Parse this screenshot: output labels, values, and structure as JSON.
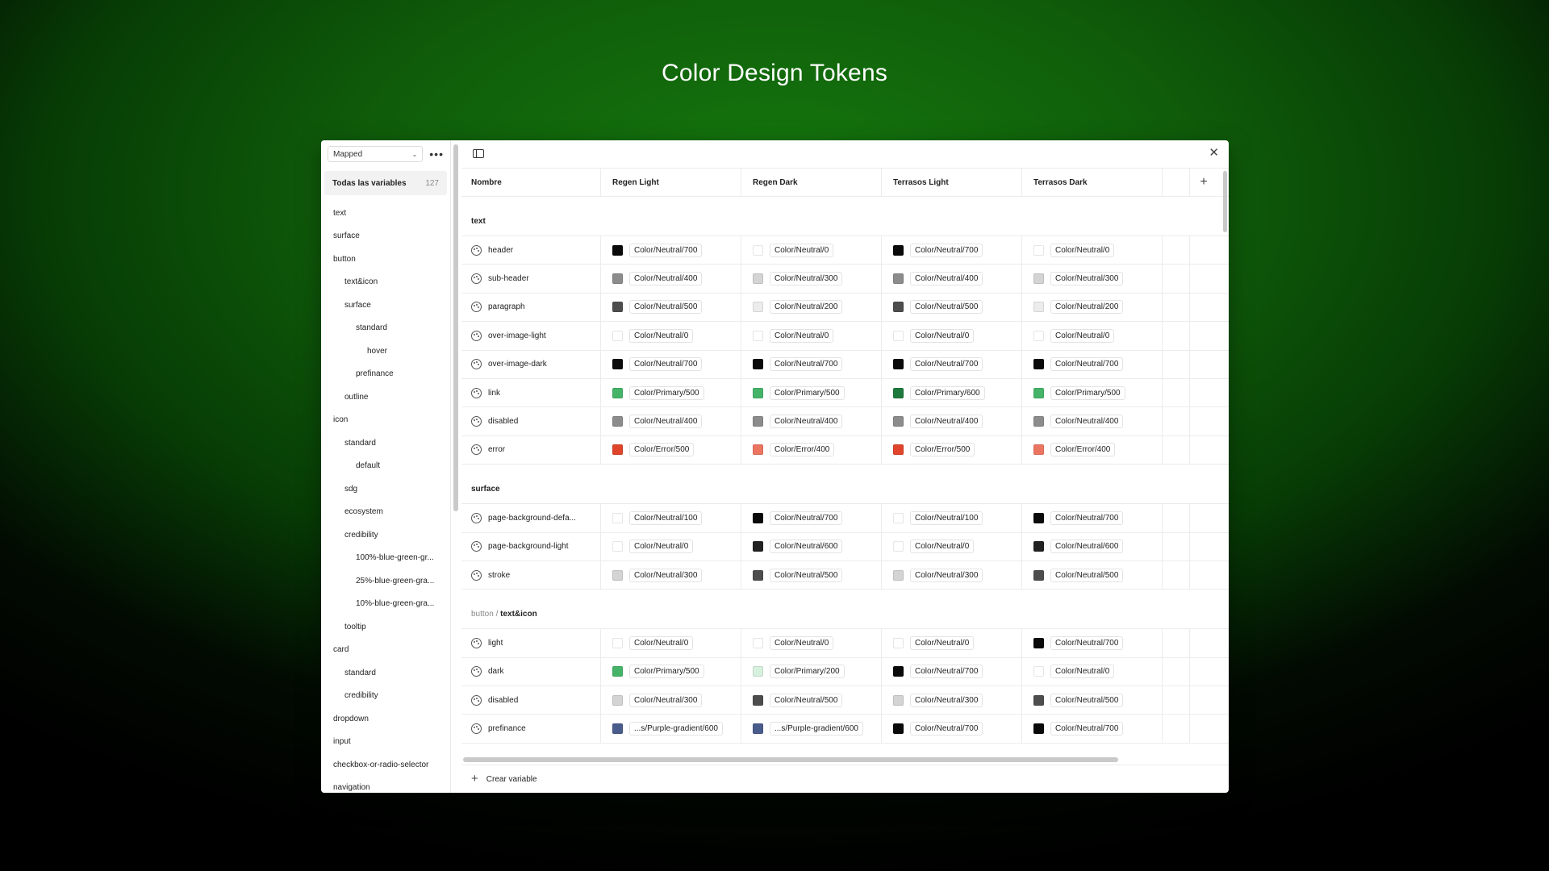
{
  "page": {
    "title": "Color Design Tokens"
  },
  "sidebar": {
    "collection": "Mapped",
    "all_label": "Todas las variables",
    "all_count": "127",
    "items": [
      {
        "label": "text",
        "depth": 0
      },
      {
        "label": "surface",
        "depth": 0
      },
      {
        "label": "button",
        "depth": 0
      },
      {
        "label": "text&icon",
        "depth": 1
      },
      {
        "label": "surface",
        "depth": 1
      },
      {
        "label": "standard",
        "depth": 2
      },
      {
        "label": "hover",
        "depth": 3
      },
      {
        "label": "prefinance",
        "depth": 2
      },
      {
        "label": "outline",
        "depth": 1
      },
      {
        "label": "icon",
        "depth": 0
      },
      {
        "label": "standard",
        "depth": 1
      },
      {
        "label": "default",
        "depth": 2
      },
      {
        "label": "sdg",
        "depth": 1
      },
      {
        "label": "ecosystem",
        "depth": 1
      },
      {
        "label": "credibility",
        "depth": 1
      },
      {
        "label": "100%-blue-green-gr...",
        "depth": 2
      },
      {
        "label": "25%-blue-green-gra...",
        "depth": 2
      },
      {
        "label": "10%-blue-green-gra...",
        "depth": 2
      },
      {
        "label": "tooltip",
        "depth": 1
      },
      {
        "label": "card",
        "depth": 0
      },
      {
        "label": "standard",
        "depth": 1
      },
      {
        "label": "credibility",
        "depth": 1
      },
      {
        "label": "dropdown",
        "depth": 0
      },
      {
        "label": "input",
        "depth": 0
      },
      {
        "label": "checkbox-or-radio-selector",
        "depth": 0
      },
      {
        "label": "navigation",
        "depth": 0
      }
    ]
  },
  "table": {
    "name_header": "Nombre",
    "modes": [
      "Regen Light",
      "Regen Dark",
      "Terrasos Light",
      "Terrasos Dark"
    ],
    "groups": [
      {
        "prefix": "",
        "title": "text",
        "rows": [
          {
            "name": "header",
            "values": [
              [
                "#0a0a0a",
                "Color/Neutral/700"
              ],
              [
                "#ffffff",
                "Color/Neutral/0"
              ],
              [
                "#0a0a0a",
                "Color/Neutral/700"
              ],
              [
                "#ffffff",
                "Color/Neutral/0"
              ]
            ]
          },
          {
            "name": "sub-header",
            "values": [
              [
                "#8c8c8c",
                "Color/Neutral/400"
              ],
              [
                "#d4d4d4",
                "Color/Neutral/300"
              ],
              [
                "#8c8c8c",
                "Color/Neutral/400"
              ],
              [
                "#d4d4d4",
                "Color/Neutral/300"
              ]
            ]
          },
          {
            "name": "paragraph",
            "values": [
              [
                "#4d4d4d",
                "Color/Neutral/500"
              ],
              [
                "#ececec",
                "Color/Neutral/200"
              ],
              [
                "#4d4d4d",
                "Color/Neutral/500"
              ],
              [
                "#ececec",
                "Color/Neutral/200"
              ]
            ]
          },
          {
            "name": "over-image-light",
            "values": [
              [
                "#ffffff",
                "Color/Neutral/0"
              ],
              [
                "#ffffff",
                "Color/Neutral/0"
              ],
              [
                "#ffffff",
                "Color/Neutral/0"
              ],
              [
                "#ffffff",
                "Color/Neutral/0"
              ]
            ]
          },
          {
            "name": "over-image-dark",
            "values": [
              [
                "#0a0a0a",
                "Color/Neutral/700"
              ],
              [
                "#0a0a0a",
                "Color/Neutral/700"
              ],
              [
                "#0a0a0a",
                "Color/Neutral/700"
              ],
              [
                "#0a0a0a",
                "Color/Neutral/700"
              ]
            ]
          },
          {
            "name": "link",
            "values": [
              [
                "#45b469",
                "Color/Primary/500"
              ],
              [
                "#45b469",
                "Color/Primary/500"
              ],
              [
                "#1e7a3c",
                "Color/Primary/600"
              ],
              [
                "#45b469",
                "Color/Primary/500"
              ]
            ]
          },
          {
            "name": "disabled",
            "values": [
              [
                "#8c8c8c",
                "Color/Neutral/400"
              ],
              [
                "#8c8c8c",
                "Color/Neutral/400"
              ],
              [
                "#8c8c8c",
                "Color/Neutral/400"
              ],
              [
                "#8c8c8c",
                "Color/Neutral/400"
              ]
            ]
          },
          {
            "name": "error",
            "values": [
              [
                "#e0452b",
                "Color/Error/500"
              ],
              [
                "#ec7561",
                "Color/Error/400"
              ],
              [
                "#e0452b",
                "Color/Error/500"
              ],
              [
                "#ec7561",
                "Color/Error/400"
              ]
            ]
          }
        ]
      },
      {
        "prefix": "",
        "title": "surface",
        "rows": [
          {
            "name": "page-background-defa...",
            "values": [
              [
                "#ffffff",
                "Color/Neutral/100"
              ],
              [
                "#0a0a0a",
                "Color/Neutral/700"
              ],
              [
                "#ffffff",
                "Color/Neutral/100"
              ],
              [
                "#0a0a0a",
                "Color/Neutral/700"
              ]
            ]
          },
          {
            "name": "page-background-light",
            "values": [
              [
                "#ffffff",
                "Color/Neutral/0"
              ],
              [
                "#222222",
                "Color/Neutral/600"
              ],
              [
                "#ffffff",
                "Color/Neutral/0"
              ],
              [
                "#222222",
                "Color/Neutral/600"
              ]
            ]
          },
          {
            "name": "stroke",
            "values": [
              [
                "#d4d4d4",
                "Color/Neutral/300"
              ],
              [
                "#4d4d4d",
                "Color/Neutral/500"
              ],
              [
                "#d4d4d4",
                "Color/Neutral/300"
              ],
              [
                "#4d4d4d",
                "Color/Neutral/500"
              ]
            ]
          }
        ]
      },
      {
        "prefix": "button / ",
        "title": "text&icon",
        "rows": [
          {
            "name": "light",
            "values": [
              [
                "#ffffff",
                "Color/Neutral/0"
              ],
              [
                "#ffffff",
                "Color/Neutral/0"
              ],
              [
                "#ffffff",
                "Color/Neutral/0"
              ],
              [
                "#0a0a0a",
                "Color/Neutral/700"
              ]
            ]
          },
          {
            "name": "dark",
            "values": [
              [
                "#45b469",
                "Color/Primary/500"
              ],
              [
                "#d6f1de",
                "Color/Primary/200"
              ],
              [
                "#0a0a0a",
                "Color/Neutral/700"
              ],
              [
                "#ffffff",
                "Color/Neutral/0"
              ]
            ]
          },
          {
            "name": "disabled",
            "values": [
              [
                "#d4d4d4",
                "Color/Neutral/300"
              ],
              [
                "#4d4d4d",
                "Color/Neutral/500"
              ],
              [
                "#d4d4d4",
                "Color/Neutral/300"
              ],
              [
                "#4d4d4d",
                "Color/Neutral/500"
              ]
            ]
          },
          {
            "name": "prefinance",
            "values": [
              [
                "#4a5c8c",
                "...s/Purple-gradient/600"
              ],
              [
                "#4a5c8c",
                "...s/Purple-gradient/600"
              ],
              [
                "#0a0a0a",
                "Color/Neutral/700"
              ],
              [
                "#0a0a0a",
                "Color/Neutral/700"
              ]
            ]
          }
        ]
      }
    ]
  },
  "footer": {
    "create_label": "Crear variable"
  }
}
